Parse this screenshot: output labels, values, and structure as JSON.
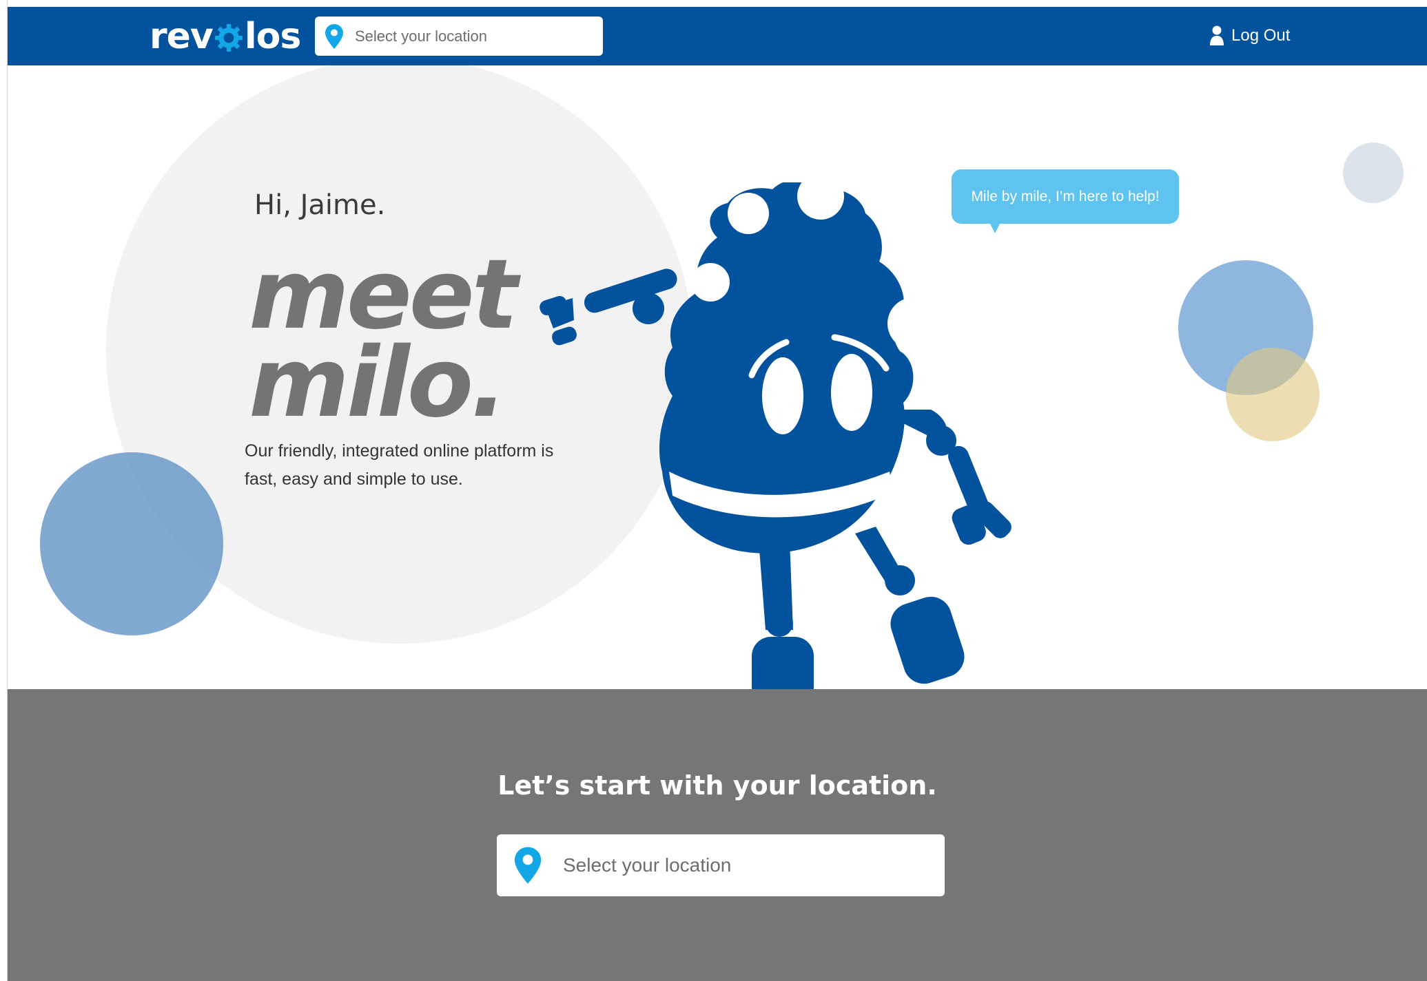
{
  "header": {
    "logo_text_left": "rev",
    "logo_text_right": "los",
    "search": {
      "placeholder": "Select your location",
      "value": ""
    },
    "logout_label": "Log Out"
  },
  "hero": {
    "greeting": "Hi, Jaime.",
    "headline_line1": "meet",
    "headline_line2": "milo.",
    "tagline_line1": "Our friendly, integrated online platform is",
    "tagline_line2": "fast, easy and simple to use.",
    "speech_bubble": "Mile by mile, I’m here to help!"
  },
  "location_section": {
    "title": "Let’s start with your location.",
    "search": {
      "placeholder": "Select your location",
      "value": ""
    }
  },
  "colors": {
    "brand_blue": "#03529e",
    "bubble_blue": "#5ec3ee",
    "pin_blue": "#14a7e8",
    "section_gray": "#767676",
    "headline_gray": "#747474"
  },
  "icons": {
    "location_pin": "map-pin-icon",
    "user": "user-icon",
    "logo_gear": "gear-icon"
  }
}
